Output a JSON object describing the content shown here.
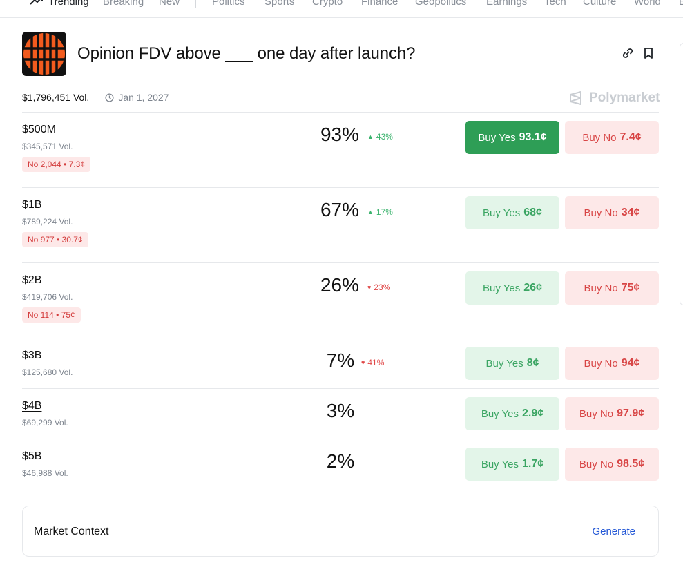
{
  "nav": {
    "items": [
      "Trending",
      "Breaking",
      "New",
      "Politics",
      "Sports",
      "Crypto",
      "Finance",
      "Geopolitics",
      "Earnings",
      "Tech",
      "Culture",
      "World",
      "E"
    ]
  },
  "header": {
    "title": "Opinion FDV above ___ one day after launch?",
    "total_volume": "$1,796,451 Vol.",
    "end_date": "Jan 1, 2027",
    "brand": "Polymarket",
    "logo_color": "#f25b1e"
  },
  "markets": [
    {
      "name": "$500M",
      "volume": "$345,571 Vol.",
      "no_chip": "No 2,044 • 7.3¢",
      "chance": "93%",
      "change": "43%",
      "trend": "up",
      "yes_label": "Buy Yes",
      "yes_price": "93.1¢",
      "no_label": "Buy No",
      "no_price": "7.4¢"
    },
    {
      "name": "$1B",
      "volume": "$789,224 Vol.",
      "no_chip": "No 977 • 30.7¢",
      "chance": "67%",
      "change": "17%",
      "trend": "up",
      "yes_label": "Buy Yes",
      "yes_price": "68¢",
      "no_label": "Buy No",
      "no_price": "34¢"
    },
    {
      "name": "$2B",
      "volume": "$419,706 Vol.",
      "no_chip": "No 114 • 75¢",
      "chance": "26%",
      "change": "23%",
      "trend": "down",
      "yes_label": "Buy Yes",
      "yes_price": "26¢",
      "no_label": "Buy No",
      "no_price": "75¢"
    },
    {
      "name": "$3B",
      "volume": "$125,680 Vol.",
      "chance": "7%",
      "change": "41%",
      "trend": "down",
      "yes_label": "Buy Yes",
      "yes_price": "8¢",
      "no_label": "Buy No",
      "no_price": "94¢"
    },
    {
      "name": "$4B",
      "volume": "$69,299 Vol.",
      "chance": "3%",
      "yes_label": "Buy Yes",
      "yes_price": "2.9¢",
      "no_label": "Buy No",
      "no_price": "97.9¢"
    },
    {
      "name": "$5B",
      "volume": "$46,988 Vol.",
      "chance": "2%",
      "yes_label": "Buy Yes",
      "yes_price": "1.7¢",
      "no_label": "Buy No",
      "no_price": "98.5¢"
    }
  ],
  "context": {
    "label": "Market Context",
    "action": "Generate"
  },
  "colors": {
    "yes_primary": "#2e9e56",
    "yes_soft": "#e3f5e9",
    "no_soft": "#fde8e8",
    "up": "#3cb46e",
    "down": "#e04848",
    "link": "#2458d6"
  }
}
